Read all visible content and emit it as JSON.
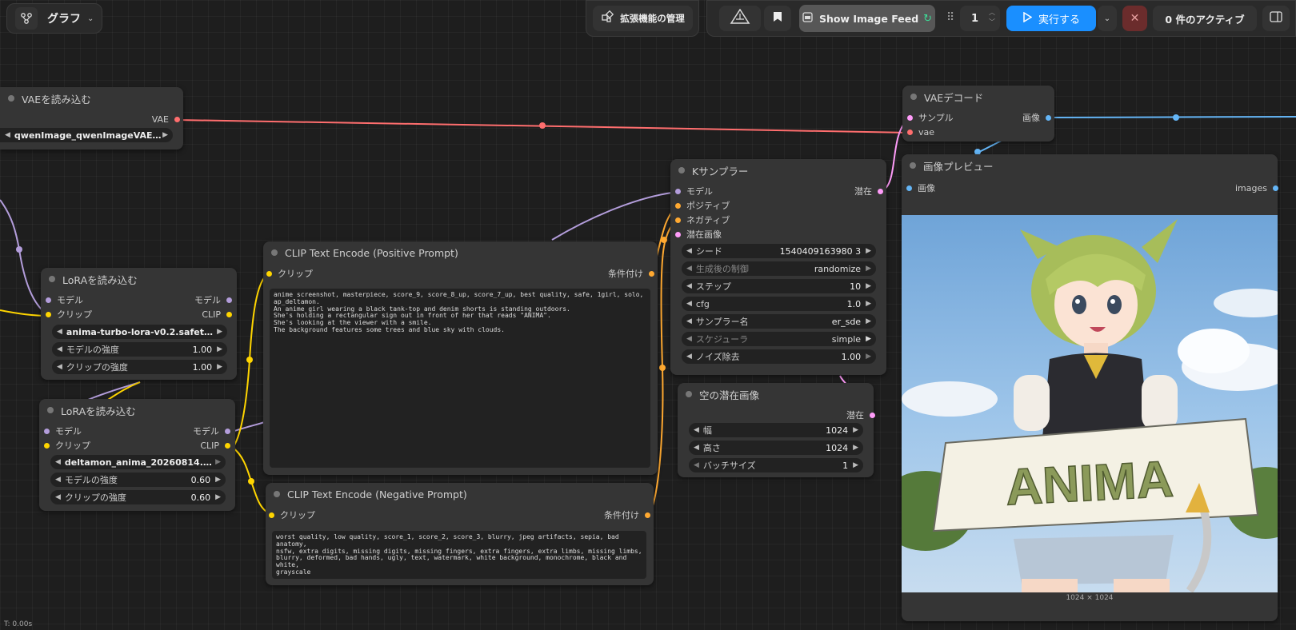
{
  "colors": {
    "model": "#b39ddb",
    "clip": "#ffd500",
    "conditioning": "#ffa931",
    "latent": "#ff9cf9",
    "vae": "#ff6e6e",
    "image": "#64b5f6",
    "run_button": "#1a8fff",
    "cancel_button": "#6b2c2c"
  },
  "topbar": {
    "graph_label": "グラフ",
    "extensions_label": "拡張機能の管理",
    "image_feed_label": "Show Image Feed",
    "queue_count": "1",
    "run_label": "実行する",
    "active_label": "0 件のアクティブ"
  },
  "nodes": {
    "vae_loader": {
      "title": "VAEを読み込む",
      "out_vae": "VAE",
      "vae_name": "qwenImage_qwenImageVAE.sa..."
    },
    "lora1": {
      "title": "LoRAを読み込む",
      "in_model": "モデル",
      "in_clip": "クリップ",
      "out_model": "モデル",
      "out_clip": "CLIP",
      "lora_name": "anima-turbo-lora-v0.2.safeten ...",
      "strength_model_label": "モデルの強度",
      "strength_model": "1.00",
      "strength_clip_label": "クリップの強度",
      "strength_clip": "1.00"
    },
    "lora2": {
      "title": "LoRAを読み込む",
      "in_model": "モデル",
      "in_clip": "クリップ",
      "out_model": "モデル",
      "out_clip": "CLIP",
      "lora_name": "deltamon_anima_20260814.saf...",
      "strength_model_label": "モデルの強度",
      "strength_model": "0.60",
      "strength_clip_label": "クリップの強度",
      "strength_clip": "0.60"
    },
    "clip_pos": {
      "title": "CLIP Text Encode (Positive Prompt)",
      "in_clip": "クリップ",
      "out_cond": "条件付け",
      "text": "anime screenshot, masterpiece, score_9, score_8_up, score_7_up, best quality, safe, 1girl, solo,\nap_deltamon.\nAn anime girl wearing a black tank-top and denim shorts is standing outdoors.\nShe's holding a rectangular sign out in front of her that reads \"ANIMA\".\nShe's looking at the viewer with a smile.\nThe background features some trees and blue sky with clouds."
    },
    "clip_neg": {
      "title": "CLIP Text Encode (Negative Prompt)",
      "in_clip": "クリップ",
      "out_cond": "条件付け",
      "text": "worst quality, low quality, score_1, score_2, score_3, blurry, jpeg artifacts, sepia, bad anatomy,\nnsfw, extra digits, missing digits, missing fingers, extra fingers, extra limbs, missing limbs,\nblurry, deformed, bad hands, ugly, text, watermark, white background, monochrome, black and white,\ngrayscale"
    },
    "ksampler": {
      "title": "Kサンプラー",
      "in_model": "モデル",
      "in_positive": "ポジティブ",
      "in_negative": "ネガティブ",
      "in_latent": "潜在画像",
      "out_latent": "潜在",
      "seed_label": "シード",
      "seed": "1540409163980 3",
      "control_label": "生成後の制御",
      "control": "randomize",
      "steps_label": "ステップ",
      "steps": "10",
      "cfg_label": "cfg",
      "cfg": "1.0",
      "sampler_label": "サンプラー名",
      "sampler": "er_sde",
      "scheduler_label": "スケジューラ",
      "scheduler": "simple",
      "denoise_label": "ノイズ除去",
      "denoise": "1.00"
    },
    "empty_latent": {
      "title": "空の潜在画像",
      "out_latent": "潜在",
      "width_label": "幅",
      "width": "1024",
      "height_label": "高さ",
      "height": "1024",
      "batch_label": "バッチサイズ",
      "batch": "1"
    },
    "vae_decode": {
      "title": "VAEデコード",
      "in_samples": "サンプル",
      "in_vae": "vae",
      "out_image": "画像"
    },
    "preview": {
      "title": "画像プレビュー",
      "in_images": "画像",
      "out_images": "images",
      "sign_text": "ANIMA",
      "size_caption": "1024 × 1024"
    }
  },
  "status": {
    "time": "T: 0.00s"
  }
}
